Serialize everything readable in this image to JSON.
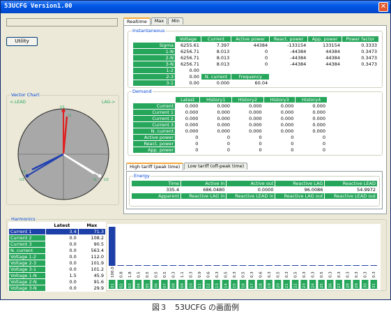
{
  "window": {
    "title": "53UCFG Version1.00",
    "close_glyph": "✕"
  },
  "toolbar": {
    "utility_label": "Utility"
  },
  "vector_chart": {
    "title": "Vector Chart",
    "lead_label": "<-LEAD",
    "lag_label": "LAG->",
    "labels": {
      "u1": "U1",
      "u2": "U2",
      "u3": "U3",
      "i1": "I1",
      "i2": "I2",
      "i3": "I3"
    },
    "colors": {
      "phase1": "#e02020",
      "phase2": "#ffffff",
      "phase3": "#2040b0",
      "disc": "#a8a8a8"
    }
  },
  "tabs": [
    {
      "label": "Realtime",
      "active": true
    },
    {
      "label": "Max",
      "active": false
    },
    {
      "label": "Min",
      "active": false
    }
  ],
  "instantaneous": {
    "title": "Instantaneous",
    "headers": [
      "",
      "Voltage",
      "Current",
      "Active power",
      "React. power",
      "App. power",
      "Power factor"
    ],
    "rows": [
      {
        "label": "Sigma",
        "cells": [
          "6255.61",
          "7.397",
          "44384",
          "-133154",
          "133154",
          "0.3333"
        ]
      },
      {
        "label": "1-N",
        "cells": [
          "6256.71",
          "8.013",
          "0",
          "-44384",
          "44384",
          "0.3473"
        ]
      },
      {
        "label": "2-N",
        "cells": [
          "6256.71",
          "8.013",
          "0",
          "-44384",
          "44384",
          "0.3473"
        ]
      },
      {
        "label": "3-N",
        "cells": [
          "6256.71",
          "8.013",
          "0",
          "-44384",
          "44384",
          "0.3473"
        ]
      },
      {
        "label": "1-2",
        "cells": [
          "0.00",
          "",
          "",
          "",
          "",
          ""
        ]
      },
      {
        "label": "2-3",
        "cells": [
          "0.00",
          "N. current",
          "Frequency",
          "",
          "",
          ""
        ]
      },
      {
        "label": "3-1",
        "cells": [
          "0.00",
          "0.000",
          "60.04",
          "",
          "",
          ""
        ]
      }
    ]
  },
  "demand": {
    "title": "Demand",
    "headers": [
      "",
      "Latest",
      "History1",
      "History2",
      "History3",
      "History4"
    ],
    "rows": [
      {
        "label": "Current",
        "cells": [
          "0.000",
          "0.000",
          "0.000",
          "0.000",
          "0.000"
        ]
      },
      {
        "label": "Current 1",
        "cells": [
          "0.000",
          "0.000",
          "0.000",
          "0.000",
          "0.000"
        ]
      },
      {
        "label": "Current 2",
        "cells": [
          "0.000",
          "0.000",
          "0.000",
          "0.000",
          "0.000"
        ]
      },
      {
        "label": "Current 3",
        "cells": [
          "0.000",
          "0.000",
          "0.000",
          "0.000",
          "0.000"
        ]
      },
      {
        "label": "N. current",
        "cells": [
          "0.000",
          "0.000",
          "0.000",
          "0.000",
          "0.000"
        ]
      },
      {
        "label": "Active power",
        "cells": [
          "0",
          "0",
          "0",
          "0",
          "0"
        ]
      },
      {
        "label": "React. power",
        "cells": [
          "0",
          "0",
          "0",
          "0",
          "0"
        ]
      },
      {
        "label": "App. power",
        "cells": [
          "0",
          "0",
          "0",
          "0",
          "0"
        ]
      }
    ]
  },
  "tariff_tabs": [
    {
      "label": "High tariff (peak time)",
      "active": true
    },
    {
      "label": "Low tariff (off-peak time)",
      "active": false
    }
  ],
  "energy": {
    "title": "Energy",
    "row1_headers": [
      "Time",
      "Active in",
      "Active out",
      "Reactive LAG",
      "Reactive LEAD"
    ],
    "row1_values": [
      "335.4",
      "686.0480",
      "0.0000",
      "96.0086",
      "54.9972"
    ],
    "row2_headers": [
      "Apparent",
      "Reactive LAG in",
      "Reactive LEAD in",
      "Reactive LAG out",
      "Reactive LEAD out"
    ],
    "row2_values": [
      "748.0297",
      "96.0086",
      "54.9972",
      "0.0000",
      "0.0000"
    ]
  },
  "harmonics": {
    "title": "Harmonics",
    "headers": [
      "",
      "Latest",
      "Max"
    ],
    "rows": [
      {
        "label": "Current 1",
        "latest": "3.4",
        "max": "71.3",
        "selected": true
      },
      {
        "label": "Current 2",
        "latest": "0.0",
        "max": "108.2",
        "selected": false
      },
      {
        "label": "Current 3",
        "latest": "0.0",
        "max": "90.5",
        "selected": false
      },
      {
        "label": "N. current",
        "latest": "0.0",
        "max": "563.4",
        "selected": false
      },
      {
        "label": "Voltage 1-2",
        "latest": "0.0",
        "max": "112.0",
        "selected": false
      },
      {
        "label": "Voltage 2-3",
        "latest": "0.0",
        "max": "101.9",
        "selected": false
      },
      {
        "label": "Voltage 3-1",
        "latest": "0.0",
        "max": "101.2",
        "selected": false
      },
      {
        "label": "Voltage 1-N",
        "latest": "1.5",
        "max": "45.9",
        "selected": false
      },
      {
        "label": "Voltage 2-N",
        "latest": "0.0",
        "max": "91.6",
        "selected": false
      },
      {
        "label": "Voltage 3-N",
        "latest": "0.0",
        "max": "29.9",
        "selected": false
      }
    ]
  },
  "chart_data": {
    "type": "bar",
    "categories": [
      "01",
      "02",
      "03",
      "04",
      "05",
      "06",
      "07",
      "08",
      "09",
      "10",
      "11",
      "12",
      "13",
      "14",
      "15",
      "16",
      "17",
      "18",
      "19",
      "20",
      "21",
      "22",
      "23",
      "24",
      "25",
      "26",
      "27",
      "28",
      "29",
      "30",
      "31"
    ],
    "values": [
      100.0,
      0.8,
      1.8,
      0.5,
      0.5,
      0.5,
      0.5,
      0.3,
      1.1,
      0.3,
      0.9,
      0.6,
      0.3,
      0.5,
      0.3,
      0.5,
      0.3,
      0.6,
      0.3,
      0.5,
      0.3,
      0.5,
      0.3,
      0.3,
      0.5,
      0.3,
      0.3,
      0.3,
      0.3,
      0.3,
      0.3
    ],
    "value_labels": [
      "100.0",
      "0.8",
      "1.8",
      "0.5",
      "0.5",
      "0.5",
      "0.5",
      "0.3",
      "1.1",
      "0.3",
      "0.9",
      "0.6",
      "0.3",
      "0.5",
      "0.3",
      "0.5",
      "0.3",
      "0.6",
      "0.3",
      "0.5",
      "0.3",
      "0.5",
      "0.3",
      "0.3",
      "0.5",
      "0.3",
      "0.3",
      "0.3",
      "0.3",
      "0.3",
      "0.3"
    ],
    "ylim": [
      0,
      100
    ],
    "bar_color": "#1c3fa8",
    "label_color": "#26a65b"
  },
  "caption": "図３　53UCFG の画面例"
}
